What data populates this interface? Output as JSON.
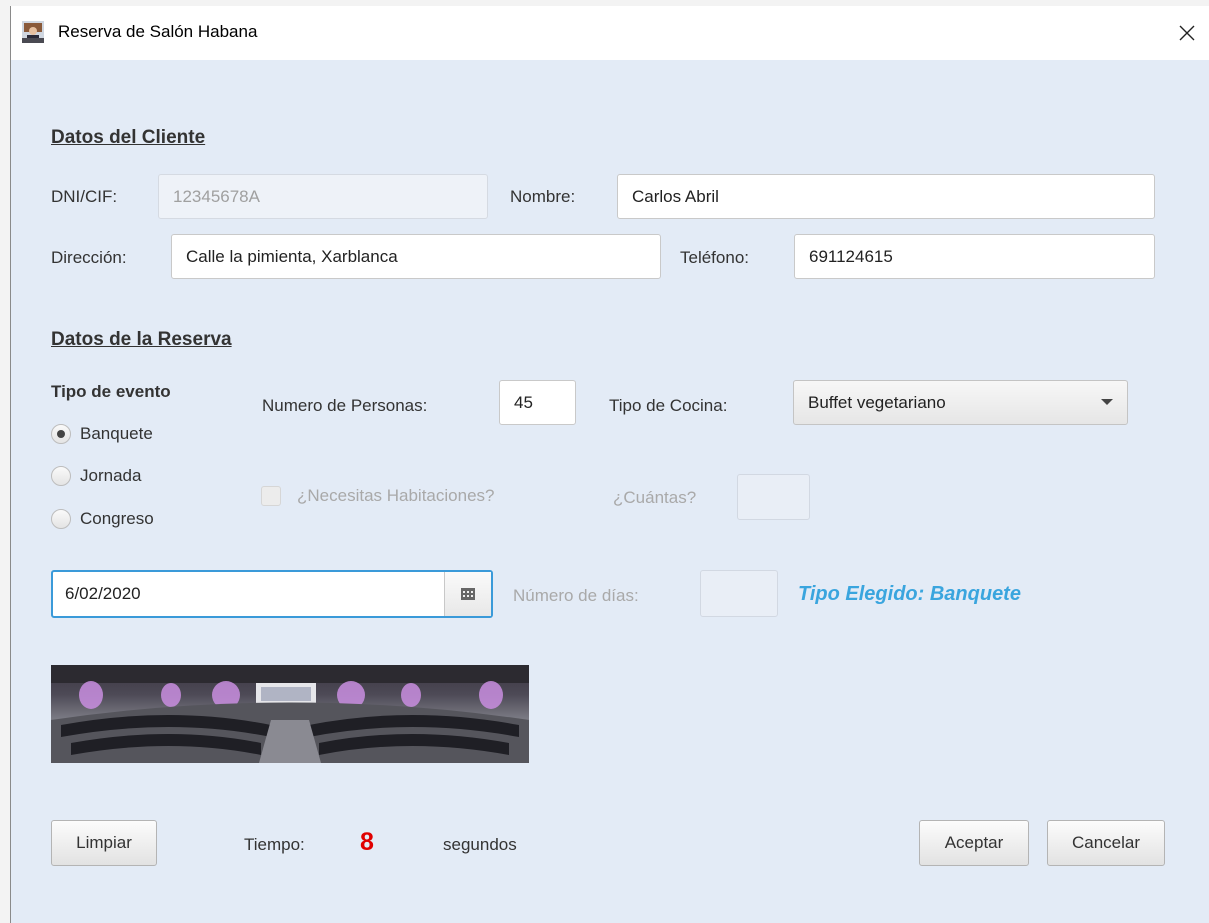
{
  "window": {
    "title": "Reserva de Salón Habana"
  },
  "client": {
    "section_title": "Datos del Cliente",
    "dni_label": "DNI/CIF:",
    "dni_value": "12345678A",
    "nombre_label": "Nombre:",
    "nombre_value": "Carlos Abril",
    "direccion_label": "Dirección:",
    "direccion_value": "Calle la pimienta, Xarblanca",
    "telefono_label": "Teléfono:",
    "telefono_value": "691124615"
  },
  "reservation": {
    "section_title": "Datos de la Reserva",
    "event_type_label": "Tipo de evento",
    "event_options": [
      "Banquete",
      "Jornada",
      "Congreso"
    ],
    "selected_event": "Banquete",
    "personas_label": "Numero de Personas:",
    "personas_value": "45",
    "cocina_label": "Tipo de Cocina:",
    "cocina_value": "Buffet vegetariano",
    "habitaciones_label": "¿Necesitas Habitaciones?",
    "cuantas_label": "¿Cuántas?",
    "date_value": "6/02/2020",
    "dias_label": "Número de días:",
    "chosen_type": "Tipo Elegido: Banquete"
  },
  "footer": {
    "clear_label": "Limpiar",
    "time_label": "Tiempo:",
    "time_value": "8",
    "time_unit": "segundos",
    "accept_label": "Aceptar",
    "cancel_label": "Cancelar"
  },
  "colors": {
    "background": "#e3ebf6",
    "accent": "#3aa5de",
    "time": "#e00000",
    "focus": "#3a9ad9"
  },
  "icons": {
    "app": "hotel-receptionist-icon",
    "close": "close-icon",
    "calendar": "calendar-icon",
    "dropdown": "chevron-down-icon"
  }
}
